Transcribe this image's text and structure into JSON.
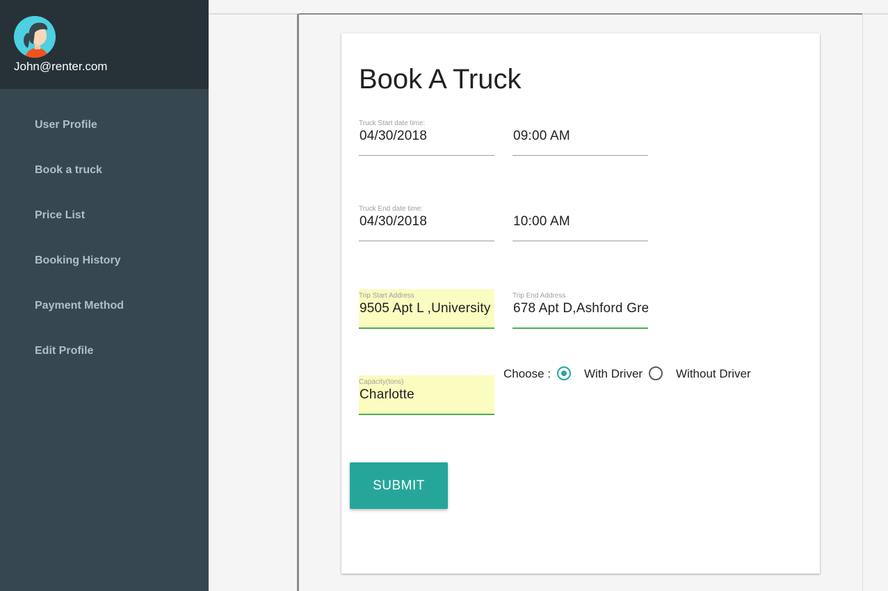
{
  "user": {
    "email": "John@renter.com"
  },
  "sidebar": {
    "items": [
      {
        "label": "User Profile"
      },
      {
        "label": "Book a truck"
      },
      {
        "label": "Price List"
      },
      {
        "label": "Booking History"
      },
      {
        "label": "Payment Method"
      },
      {
        "label": "Edit Profile"
      }
    ]
  },
  "form": {
    "title": "Book A Truck",
    "start": {
      "label": "Truck Start date time:",
      "date": "04/30/2018",
      "time": "09:00 AM"
    },
    "end": {
      "label": "Truck End date time:",
      "date": "04/30/2018",
      "time": "10:00 AM"
    },
    "trip_start": {
      "label": "Trip Start Address",
      "value": "9505 Apt L ,University"
    },
    "trip_end": {
      "label": "Trip End Address",
      "value": "678 Apt D,Ashford Gre"
    },
    "capacity": {
      "label": "Capacity(tons)",
      "value": "Charlotte"
    },
    "driver_choice": {
      "label": "Choose :",
      "options": [
        {
          "label": "With Driver",
          "selected": true
        },
        {
          "label": "Without Driver",
          "selected": false
        }
      ]
    },
    "submit_label": "SUBMIT"
  },
  "colors": {
    "sidebar": "#37474f",
    "sidebar_header": "#263238",
    "accent": "#26a69a",
    "autofill": "#fafcc0",
    "valid_underline": "#4caf50"
  },
  "icons": {
    "avatar": "user-avatar-icon"
  }
}
